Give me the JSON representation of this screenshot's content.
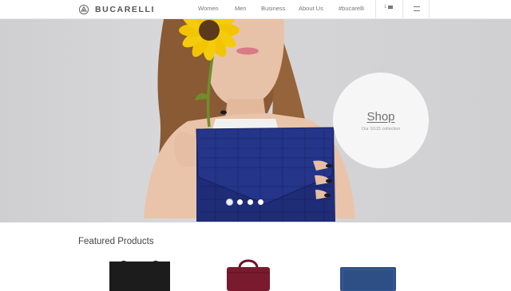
{
  "brand": {
    "name": "BUCARELLI"
  },
  "nav": {
    "items": [
      {
        "label": "Women"
      },
      {
        "label": "Men"
      },
      {
        "label": "Business"
      },
      {
        "label": "About Us"
      },
      {
        "label": "#bucarelli"
      }
    ],
    "language": "1"
  },
  "hero": {
    "shop_label": "Shop",
    "shop_subtitle": "Our SS15 collection",
    "slide_count": 4,
    "active_slide": 1
  },
  "featured": {
    "title": "Featured Products",
    "products": [
      {
        "name": "black-tote-bag",
        "color": "#1c1c1c"
      },
      {
        "name": "burgundy-briefcase",
        "color": "#7a1a2e"
      },
      {
        "name": "blue-folio",
        "color": "#2d4f86"
      }
    ]
  },
  "colors": {
    "accent": "#8aa33a",
    "clutch": "#1f2d78",
    "sunflower": "#f2c500"
  }
}
